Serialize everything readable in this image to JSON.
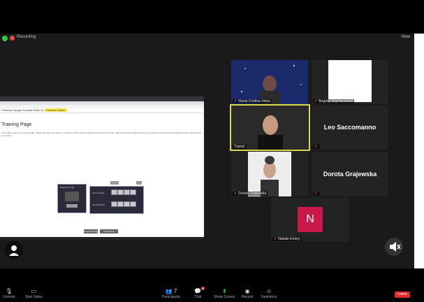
{
  "window": {
    "recording_label": "Recording",
    "view_label": "View"
  },
  "share": {
    "appbar_left": "Personal Jungle Goodlist",
    "appbar_mid": "Rank",
    "appbar_tab": "Hu",
    "appbar_highlight": "Problem Solver",
    "page_title": "Training Page",
    "body_text": "Instructions: this is the training page. Watch the video and rank the ‘Practice’ clips by their similarity with the reference clip. Indicate the first ranking positions for each clip using the buttons below and then click submit to continue.",
    "panel1_title": "Reference Clip",
    "panel2_title1": "Clip A Instant",
    "panel2_title2": "Clip B Instant",
    "play_label": "Play",
    "button_prev": "Previous Page",
    "button_next": "Submit and Continue"
  },
  "participants": [
    {
      "name": "Flavia Cristina Vieira",
      "type": "video"
    },
    {
      "name": "Bogdan Szymanowski",
      "type": "blank"
    },
    {
      "name": "Trainer",
      "type": "video"
    },
    {
      "name": "Leo Saccomanno",
      "type": "name"
    },
    {
      "name": "Dorota Grajewska",
      "type": "video"
    },
    {
      "name": "Dorota Grajewska",
      "type": "name"
    },
    {
      "name": "Natalie Emery",
      "type": "avatar",
      "initial": "N"
    }
  ],
  "toolbar": {
    "items": [
      {
        "label": "Unmute",
        "icon": "mic-icon"
      },
      {
        "label": "Start Video",
        "icon": "video-icon"
      },
      {
        "label": "Participants",
        "icon": "participants-icon",
        "count": "7"
      },
      {
        "label": "Chat",
        "icon": "chat-icon",
        "badge": "4"
      },
      {
        "label": "Share Screen",
        "icon": "share-screen-icon"
      },
      {
        "label": "Record",
        "icon": "record-icon"
      },
      {
        "label": "Reactions",
        "icon": "reactions-icon"
      }
    ],
    "leave_label": "Leave"
  },
  "colors": {
    "accent_green": "#2ecc40",
    "leave_red": "#e02828",
    "avatar_pink": "#c9184a",
    "speaker_highlight": "#d7dc4a"
  }
}
